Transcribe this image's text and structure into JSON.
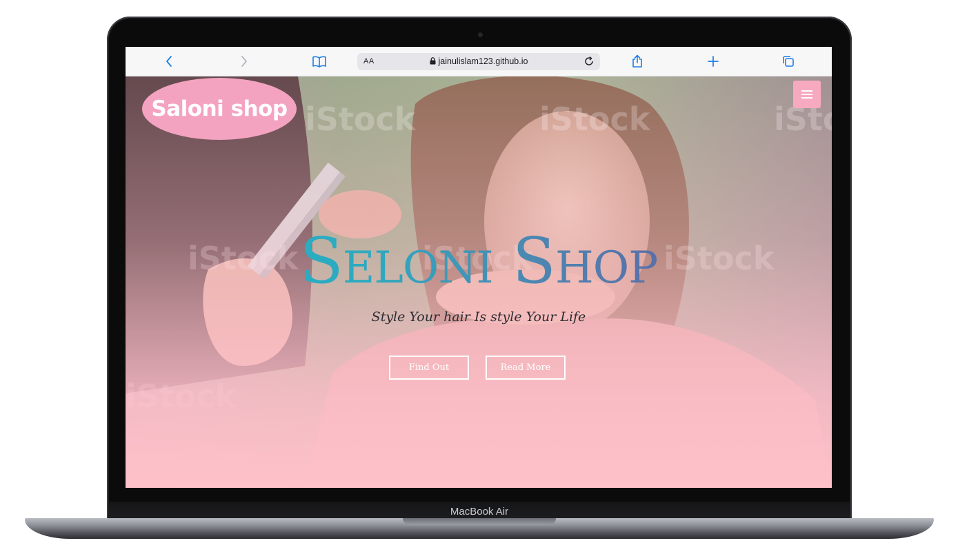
{
  "device": {
    "label": "MacBook Air"
  },
  "browser": {
    "reader_label": "AA",
    "url": "jainulislam123.github.io"
  },
  "site": {
    "logo_text": "Saloni shop",
    "hero_title": "Seloni Shop",
    "tagline": "Style Your hair Is style Your Life",
    "buttons": [
      "Find Out",
      "Read More"
    ],
    "colors": {
      "logo_bg": "#f3a3c0",
      "menu_bg": "#f7a9bf",
      "overlay": "#ffc1c9",
      "title_gradient_start": "#1fb4c4",
      "title_gradient_end": "#6a4f9d"
    },
    "icons": [
      "hamburger-menu-icon"
    ]
  }
}
